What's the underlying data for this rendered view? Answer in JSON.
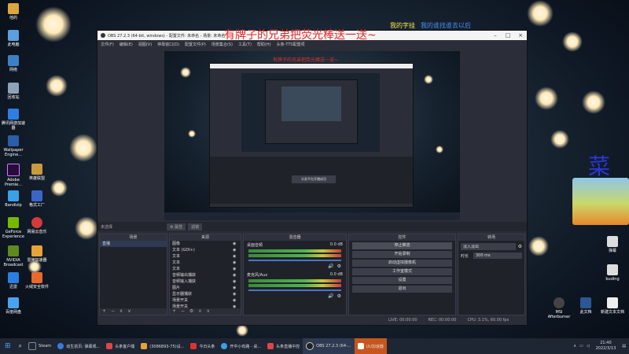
{
  "overlay": {
    "top_banner": "有牌子的兄弟把荧光棒送一送~",
    "follow_text_1": "我的字挂",
    "follow_text_2": "我的谁找谁去以后",
    "side_char_small": "菜",
    "side_char_big": "菜",
    "nested_banner": "有牌子的兄弟把荧光棒送一送~",
    "nested_toast": "头条平台开播成功"
  },
  "desktop_icons_left": [
    {
      "label": "他的"
    },
    {
      "label": "此电脑"
    },
    {
      "label": "网络"
    },
    {
      "label": "回收站"
    },
    {
      "label": "腾讯网游加速器"
    },
    {
      "label": "Wallpaper Engine..."
    },
    {
      "label": "Adobe Premie..."
    },
    {
      "label": "Bandizip"
    },
    {
      "label": "GeForce Experience"
    },
    {
      "label": "NVIDIA Broadcast"
    },
    {
      "label": "迅雷"
    },
    {
      "label": "百度网盘"
    }
  ],
  "desktop_icons_col2": [
    {
      "label": "英雄联盟"
    },
    {
      "label": "格式工厂"
    },
    {
      "label": "网易云音乐"
    },
    {
      "label": "雷神加速器"
    },
    {
      "label": "火绒安全软件"
    }
  ],
  "desktop_icons_right": [
    {
      "label": "MSI Afterburner"
    },
    {
      "label": "此文档"
    },
    {
      "label": "新建文本文档"
    },
    {
      "label": "弹幕"
    },
    {
      "label": "buding"
    }
  ],
  "obs": {
    "title": "OBS 27.2.3 (64-bit, windows) - 配置文件: 未命名 - 场景: 未命名",
    "menu": [
      "文件(F)",
      "编辑(E)",
      "视图(V)",
      "停靠窗口(D)",
      "配置文件(P)",
      "场景集合(S)",
      "工具(T)",
      "帮助(H)",
      "头条-TTS配置项"
    ],
    "scene_bar_label": "未选择",
    "scene_bar_buttons": [
      "⚙ 属性",
      "滤镜"
    ],
    "docks": {
      "scenes": {
        "header": "场景",
        "items": [
          "直播"
        ]
      },
      "sources": {
        "header": "来源",
        "items": [
          "图像",
          "文本 (GDI+)",
          "文本",
          "文本",
          "文本",
          "音频输出捕获",
          "音频输入捕获",
          "图片",
          "显示器捕获",
          "场景开关",
          "场景开关"
        ]
      },
      "mixer": {
        "header": "混音器",
        "tracks": [
          {
            "name": "桌面音频",
            "level": "0.0 dB"
          },
          {
            "name": "麦克风/Aux",
            "level": "0.0 dB"
          }
        ]
      },
      "transitions": {
        "header": "转场",
        "type": "淡入淡出",
        "duration_label": "时长",
        "duration": "300 ms"
      },
      "controls": {
        "header": "控件",
        "buttons": [
          "停止推流",
          "开始录制",
          "启动虚拟摄像机",
          "工作室模式",
          "设置",
          "退出"
        ]
      }
    },
    "status": {
      "live": "LIVE: 00:00:00",
      "rec": "REC: 00:00:00",
      "cpu": "CPU: 3.1%, 60.00 fps"
    }
  },
  "taskbar": {
    "items": [
      {
        "label": "Steam",
        "color": "#1b2838"
      },
      {
        "label": "动生前页: 弹幕观...",
        "color": "#3a7bd5"
      },
      {
        "label": "头条客户端",
        "color": "#e04444"
      },
      {
        "label": "(3086893-75)设...",
        "color": "#e8a23a"
      },
      {
        "label": "今日头条",
        "color": "#d33"
      },
      {
        "label": "开中小有路 - 桌...",
        "color": "#3aa0e8"
      },
      {
        "label": "头条直播中控",
        "color": "#e04444"
      },
      {
        "label": "OBS 27.2.3 (64-...",
        "color": "#444"
      },
      {
        "label": "UU加速器",
        "color": "#e87a2a"
      }
    ],
    "clock_time": "21:40",
    "clock_date": "2022/3/13"
  }
}
